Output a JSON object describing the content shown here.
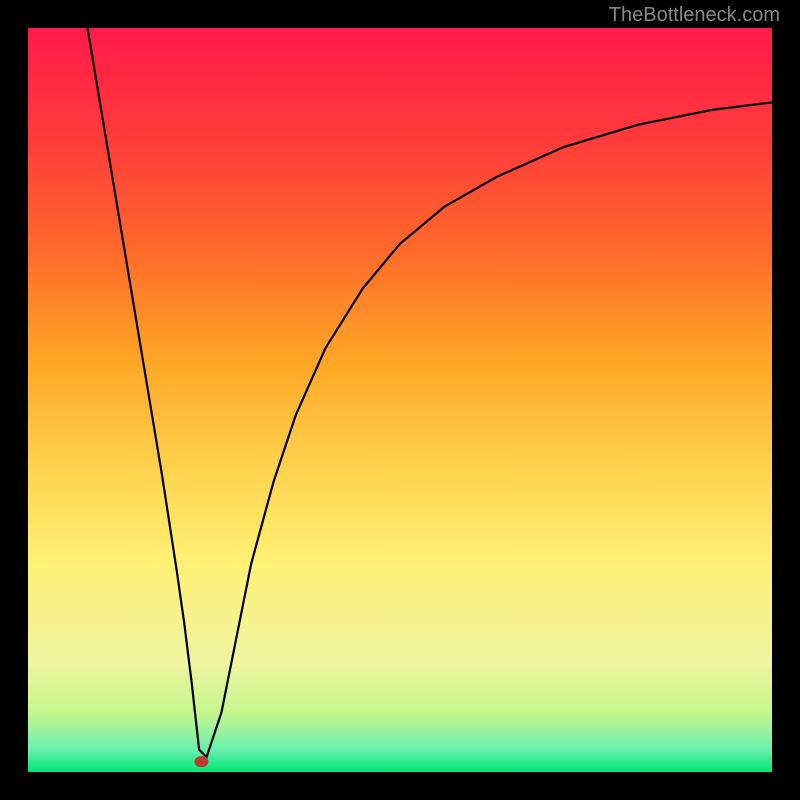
{
  "watermark": "TheBottleneck.com",
  "chart_data": {
    "type": "line",
    "title": "",
    "xlabel": "",
    "ylabel": "",
    "xlim": [
      0,
      100
    ],
    "ylim": [
      0,
      100
    ],
    "background_gradient": {
      "stops": [
        {
          "offset": 0.0,
          "color": "#ff1a4a"
        },
        {
          "offset": 0.15,
          "color": "#ff3b3b"
        },
        {
          "offset": 0.3,
          "color": "#ff6a2a"
        },
        {
          "offset": 0.45,
          "color": "#ffa726"
        },
        {
          "offset": 0.6,
          "color": "#ffd54f"
        },
        {
          "offset": 0.72,
          "color": "#fff176"
        },
        {
          "offset": 0.85,
          "color": "#f0f4a0"
        },
        {
          "offset": 0.92,
          "color": "#c6f68d"
        },
        {
          "offset": 0.97,
          "color": "#69f0ae"
        },
        {
          "offset": 1.0,
          "color": "#00e676"
        }
      ]
    },
    "series": [
      {
        "name": "curve",
        "x": [
          8,
          10,
          12,
          14,
          16,
          18,
          20,
          21,
          22,
          23,
          24,
          26,
          28,
          30,
          33,
          36,
          40,
          45,
          50,
          56,
          63,
          72,
          82,
          92,
          100
        ],
        "values": [
          100,
          88,
          76,
          64,
          52,
          40,
          27,
          20,
          12,
          3,
          2,
          8,
          18,
          28,
          39,
          48,
          57,
          65,
          71,
          76,
          80,
          84,
          87,
          89,
          90
        ]
      }
    ],
    "marker": {
      "x": 23.3,
      "y": 1.4,
      "color": "#c0392b"
    }
  }
}
